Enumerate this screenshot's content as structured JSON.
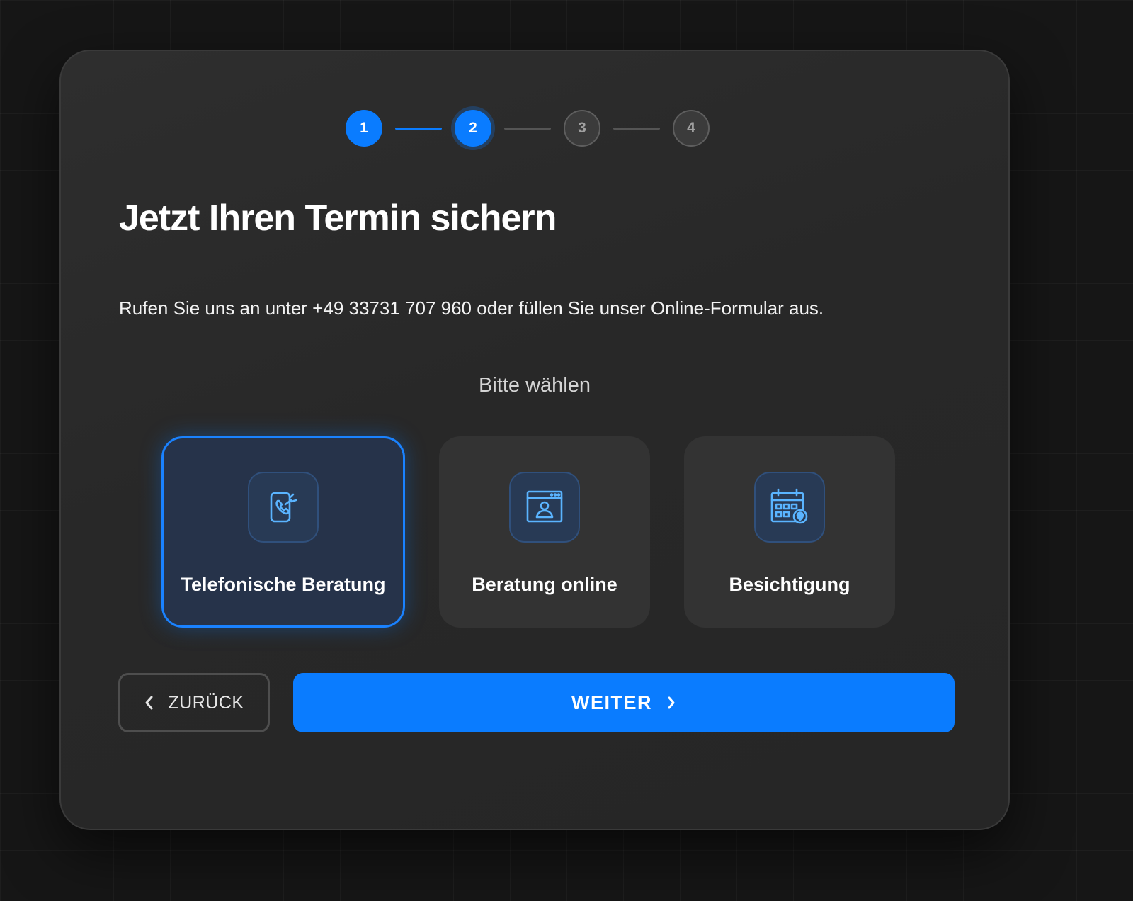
{
  "stepper": {
    "steps": [
      {
        "number": "1",
        "state": "done"
      },
      {
        "number": "2",
        "state": "active"
      },
      {
        "number": "3",
        "state": "todo"
      },
      {
        "number": "4",
        "state": "todo"
      }
    ]
  },
  "heading": {
    "title": "Jetzt Ihren Termin sichern",
    "subtitle": "Rufen Sie uns an unter +49 33731 707 960 oder füllen Sie unser Online-Formular aus."
  },
  "selection": {
    "prompt": "Bitte wählen",
    "options": [
      {
        "label": "Telefonische Beratung",
        "icon": "phone-icon",
        "selected": true
      },
      {
        "label": "Beratung online",
        "icon": "video-call-icon",
        "selected": false
      },
      {
        "label": "Besichtigung",
        "icon": "calendar-location-icon",
        "selected": false
      }
    ]
  },
  "actions": {
    "back_label": "ZURÜCK",
    "next_label": "WEITER"
  },
  "colors": {
    "accent": "#0a7cff",
    "card_background": "#2a2a2a",
    "page_background": "#161616"
  }
}
